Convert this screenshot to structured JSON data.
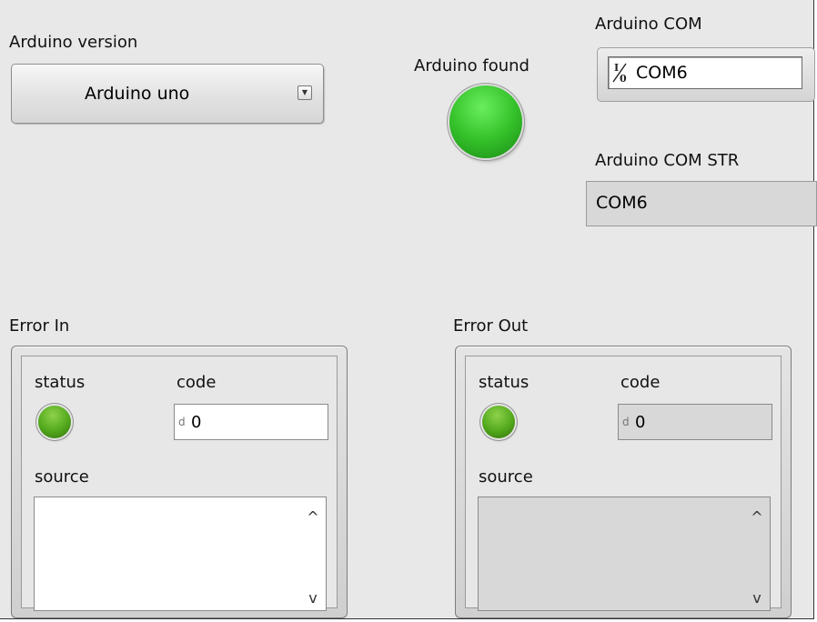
{
  "arduino_version": {
    "label": "Arduino version",
    "selected": "Arduino uno",
    "dropdown_glyph": "▼"
  },
  "arduino_found": {
    "label": "Arduino found",
    "state": "on",
    "color": "#35c22a"
  },
  "arduino_com": {
    "label": "Arduino COM",
    "visa_icon": "I/0",
    "value": "COM6"
  },
  "arduino_com_str": {
    "label": "Arduino COM STR",
    "value": "COM6"
  },
  "error_in": {
    "title": "Error In",
    "status_label": "status",
    "code_label": "code",
    "code_radix": "d",
    "code_value": "0",
    "source_label": "source",
    "source_value": "",
    "scroll_up": "^",
    "scroll_down": "v"
  },
  "error_out": {
    "title": "Error Out",
    "status_label": "status",
    "code_label": "code",
    "code_radix": "d",
    "code_value": "0",
    "source_label": "source",
    "source_value": "",
    "scroll_up": "^",
    "scroll_down": "v"
  }
}
